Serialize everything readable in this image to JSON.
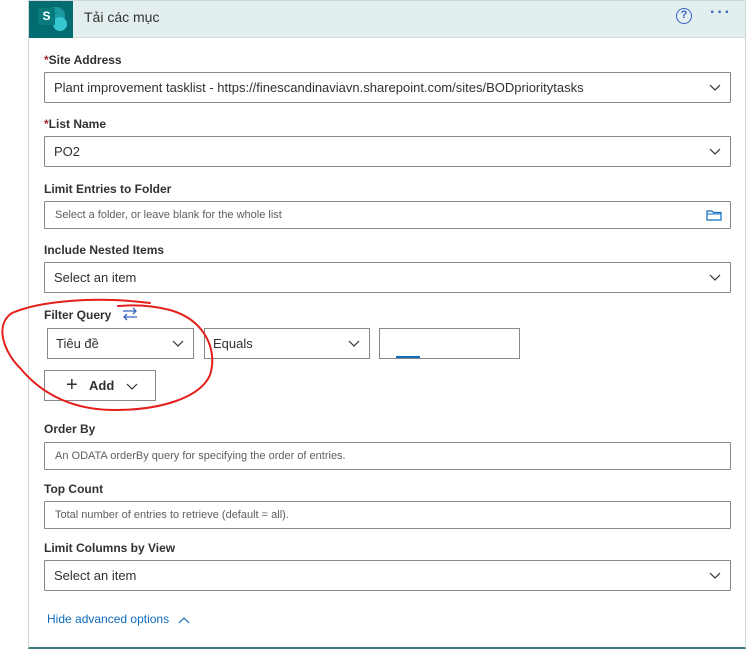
{
  "header": {
    "title": "Tải các mục",
    "logo_letter": "S",
    "help_glyph": "?",
    "more_glyph": "···",
    "colors": {
      "accent": "#036c70",
      "header_bg": "#e3eeee",
      "icon": "#3b62c2"
    }
  },
  "fields": {
    "site_address": {
      "label": "Site Address",
      "required_mark": "*",
      "value": "Plant improvement tasklist - https://finescandinaviavn.sharepoint.com/sites/BODprioritytasks"
    },
    "list_name": {
      "label": "List Name",
      "required_mark": "*",
      "value": "PO2"
    },
    "limit_folder": {
      "label": "Limit Entries to Folder",
      "placeholder": "Select a folder, or leave blank for the whole list"
    },
    "nested": {
      "label": "Include Nested Items",
      "value": "Select an item"
    },
    "filter": {
      "label": "Filter Query",
      "field_value": "Tiêu đề",
      "operator_value": "Equals",
      "value": "",
      "add_label": "Add"
    },
    "order_by": {
      "label": "Order By",
      "placeholder": "An ODATA orderBy query for specifying the order of entries."
    },
    "top_count": {
      "label": "Top Count",
      "placeholder": "Total number of entries to retrieve (default = all)."
    },
    "limit_columns": {
      "label": "Limit Columns by View",
      "value": "Select an item"
    }
  },
  "footer": {
    "advanced_link": "Hide advanced options"
  },
  "icons": [
    "sharepoint-logo-icon",
    "help-icon",
    "more-icon",
    "chevron-down-icon",
    "folder-icon",
    "swap-icon",
    "plus-icon",
    "chevron-up-icon"
  ]
}
